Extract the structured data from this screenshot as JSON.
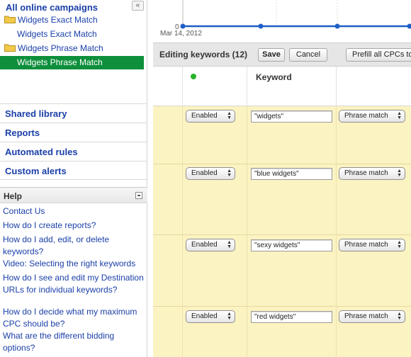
{
  "campaign_tree": {
    "root_label": "All online campaigns",
    "collapse_symbol": "«",
    "items": [
      {
        "label": "Widgets Exact Match",
        "type": "campaign",
        "selected": false
      },
      {
        "label": "Widgets Exact Match",
        "type": "ad_group",
        "selected": false
      },
      {
        "label": "Widgets Phrase Match",
        "type": "campaign",
        "selected": false
      },
      {
        "label": "Widgets Phrase Match",
        "type": "ad_group",
        "selected": true
      }
    ]
  },
  "nav": {
    "shared_library": "Shared library",
    "reports": "Reports",
    "automated_rules": "Automated rules",
    "custom_alerts": "Custom alerts"
  },
  "help": {
    "title": "Help",
    "links": [
      "Contact Us",
      "How do I create reports?",
      "How do I add, edit, or delete keywords?",
      "Video: Selecting the right keywords",
      "How do I see and edit my Destination URLs for individual keywords?",
      "How do I decide what my maximum CPC should be?",
      "What are the different bidding options?"
    ]
  },
  "chart": {
    "y_tick": "0",
    "x_label": "Mar 14, 2012",
    "line_color": "#1f5fc8"
  },
  "editor": {
    "title": "Editing keywords (12)",
    "save_label": "Save",
    "cancel_label": "Cancel",
    "prefill_label": "Prefill all CPCs to"
  },
  "table": {
    "keyword_header": "Keyword",
    "status_dot_color": "#27b327",
    "rows": [
      {
        "status": "Enabled",
        "keyword": "\"widgets\"",
        "match_type": "Phrase match"
      },
      {
        "status": "Enabled",
        "keyword": "\"blue widgets\"",
        "match_type": "Phrase match"
      },
      {
        "status": "Enabled",
        "keyword": "\"sexy widgets\"",
        "match_type": "Phrase match"
      },
      {
        "status": "Enabled",
        "keyword": "\"red widgets\"",
        "match_type": "Phrase match"
      }
    ]
  },
  "colors": {
    "selected_item_bg": "#0e8f3b",
    "link": "#1a3fa8",
    "row_bg": "#fcf3c2"
  }
}
